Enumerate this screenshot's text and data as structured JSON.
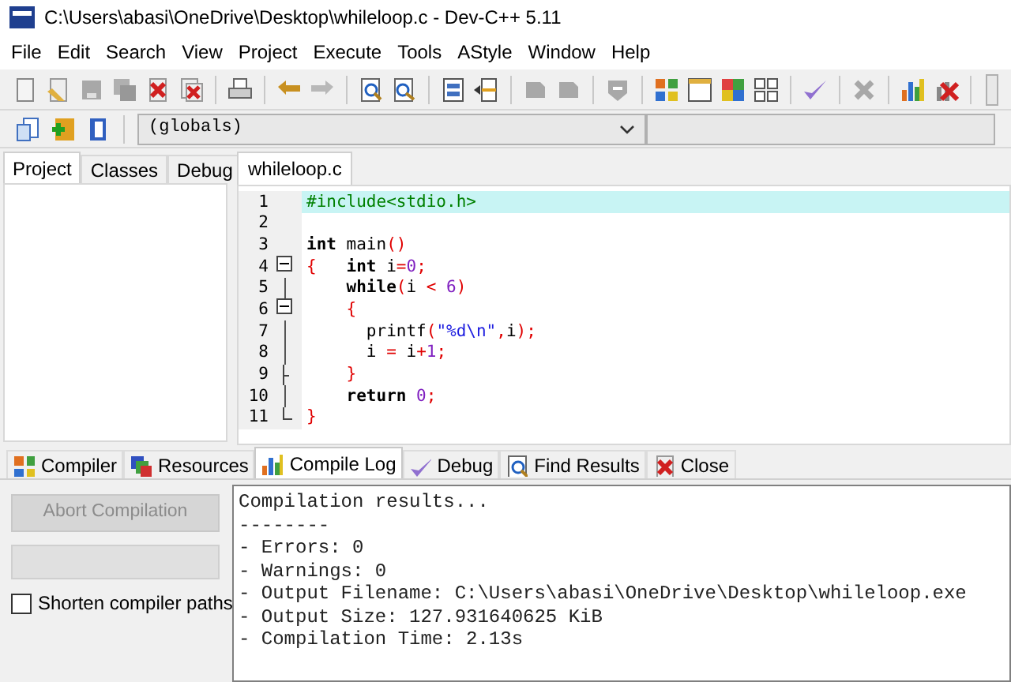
{
  "window": {
    "title": "C:\\Users\\abasi\\OneDrive\\Desktop\\whileloop.c - Dev-C++ 5.11"
  },
  "menu": [
    "File",
    "Edit",
    "Search",
    "View",
    "Project",
    "Execute",
    "Tools",
    "AStyle",
    "Window",
    "Help"
  ],
  "scope_combo": {
    "value": "(globals)"
  },
  "left_tabs": [
    {
      "label": "Project",
      "selected": true
    },
    {
      "label": "Classes",
      "selected": false
    },
    {
      "label": "Debug",
      "selected": false
    }
  ],
  "editor": {
    "tabs": [
      {
        "label": "whileloop.c",
        "selected": true
      }
    ],
    "lines": [
      {
        "number": "1",
        "highlighted": true,
        "tokens": [
          {
            "text": "#include<stdio.h>",
            "kind": "preproc"
          }
        ]
      },
      {
        "number": "2",
        "highlighted": false
      },
      {
        "number": "3",
        "highlighted": false,
        "tokens": [
          {
            "text": "int",
            "kind": "keyword"
          },
          {
            "text": " main",
            "kind": "plain"
          },
          {
            "text": "()",
            "kind": "symbol"
          }
        ]
      },
      {
        "number": "4",
        "highlighted": false,
        "kind": "open",
        "tokens": [
          {
            "text": "{",
            "kind": "symbol"
          },
          {
            "text": "   int",
            "kind": "keyword"
          },
          {
            "text": " i",
            "kind": "plain"
          },
          {
            "text": "=",
            "kind": "symbol"
          },
          {
            "text": "0",
            "kind": "number"
          },
          {
            "text": ";",
            "kind": "symbol"
          }
        ]
      },
      {
        "number": "5",
        "highlighted": false,
        "kind": "line",
        "tokens": [
          {
            "text": "    while",
            "kind": "keyword"
          },
          {
            "text": "(",
            "kind": "symbol"
          },
          {
            "text": "i ",
            "kind": "plain"
          },
          {
            "text": "<",
            "kind": "symbol"
          },
          {
            "text": " 6",
            "kind": "number"
          },
          {
            "text": ")",
            "kind": "symbol"
          }
        ]
      },
      {
        "number": "6",
        "highlighted": false,
        "kind": "open",
        "tokens": [
          {
            "text": "    {",
            "kind": "symbol"
          }
        ]
      },
      {
        "number": "7",
        "highlighted": false,
        "kind": "line",
        "tokens": [
          {
            "text": "      printf",
            "kind": "plain"
          },
          {
            "text": "(",
            "kind": "symbol"
          },
          {
            "text": "\"%d\\n\"",
            "kind": "string"
          },
          {
            "text": ",",
            "kind": "symbol"
          },
          {
            "text": "i",
            "kind": "plain"
          },
          {
            "text": ");",
            "kind": "symbol"
          }
        ]
      },
      {
        "number": "8",
        "highlighted": false,
        "kind": "line",
        "tokens": [
          {
            "text": "      i ",
            "kind": "plain"
          },
          {
            "text": "=",
            "kind": "symbol"
          },
          {
            "text": " i",
            "kind": "plain"
          },
          {
            "text": "+",
            "kind": "symbol"
          },
          {
            "text": "1",
            "kind": "number"
          },
          {
            "text": ";",
            "kind": "symbol"
          }
        ]
      },
      {
        "number": "9",
        "highlighted": false,
        "kind": "end",
        "tokens": [
          {
            "text": "    }",
            "kind": "symbol"
          }
        ]
      },
      {
        "number": "10",
        "highlighted": false,
        "kind": "line",
        "tokens": [
          {
            "text": "    return",
            "kind": "keyword"
          },
          {
            "text": " 0",
            "kind": "number"
          },
          {
            "text": ";",
            "kind": "symbol"
          }
        ]
      },
      {
        "number": "11",
        "highlighted": false,
        "kind": "last",
        "tokens": [
          {
            "text": "}",
            "kind": "symbol"
          }
        ]
      }
    ]
  },
  "bottom_tabs": [
    {
      "label": "Compiler",
      "selected": false
    },
    {
      "label": "Resources",
      "selected": false
    },
    {
      "label": "Compile Log",
      "selected": true
    },
    {
      "label": "Debug",
      "selected": false
    },
    {
      "label": "Find Results",
      "selected": false
    },
    {
      "label": "Close",
      "selected": false
    }
  ],
  "compile_panel": {
    "abort_button": {
      "label": "Abort Compilation",
      "disabled": true
    },
    "progress": {
      "level": 0
    },
    "shorten_paths": {
      "label": "Shorten compiler paths",
      "checked": false
    }
  },
  "compile_log": [
    "Compilation results...",
    "--------",
    "- Errors: 0",
    "- Warnings: 0",
    "- Output Filename: C:\\Users\\abasi\\OneDrive\\Desktop\\whileloop.exe",
    "- Output Size: 127.931640625 KiB",
    "- Compilation Time: 2.13s"
  ]
}
